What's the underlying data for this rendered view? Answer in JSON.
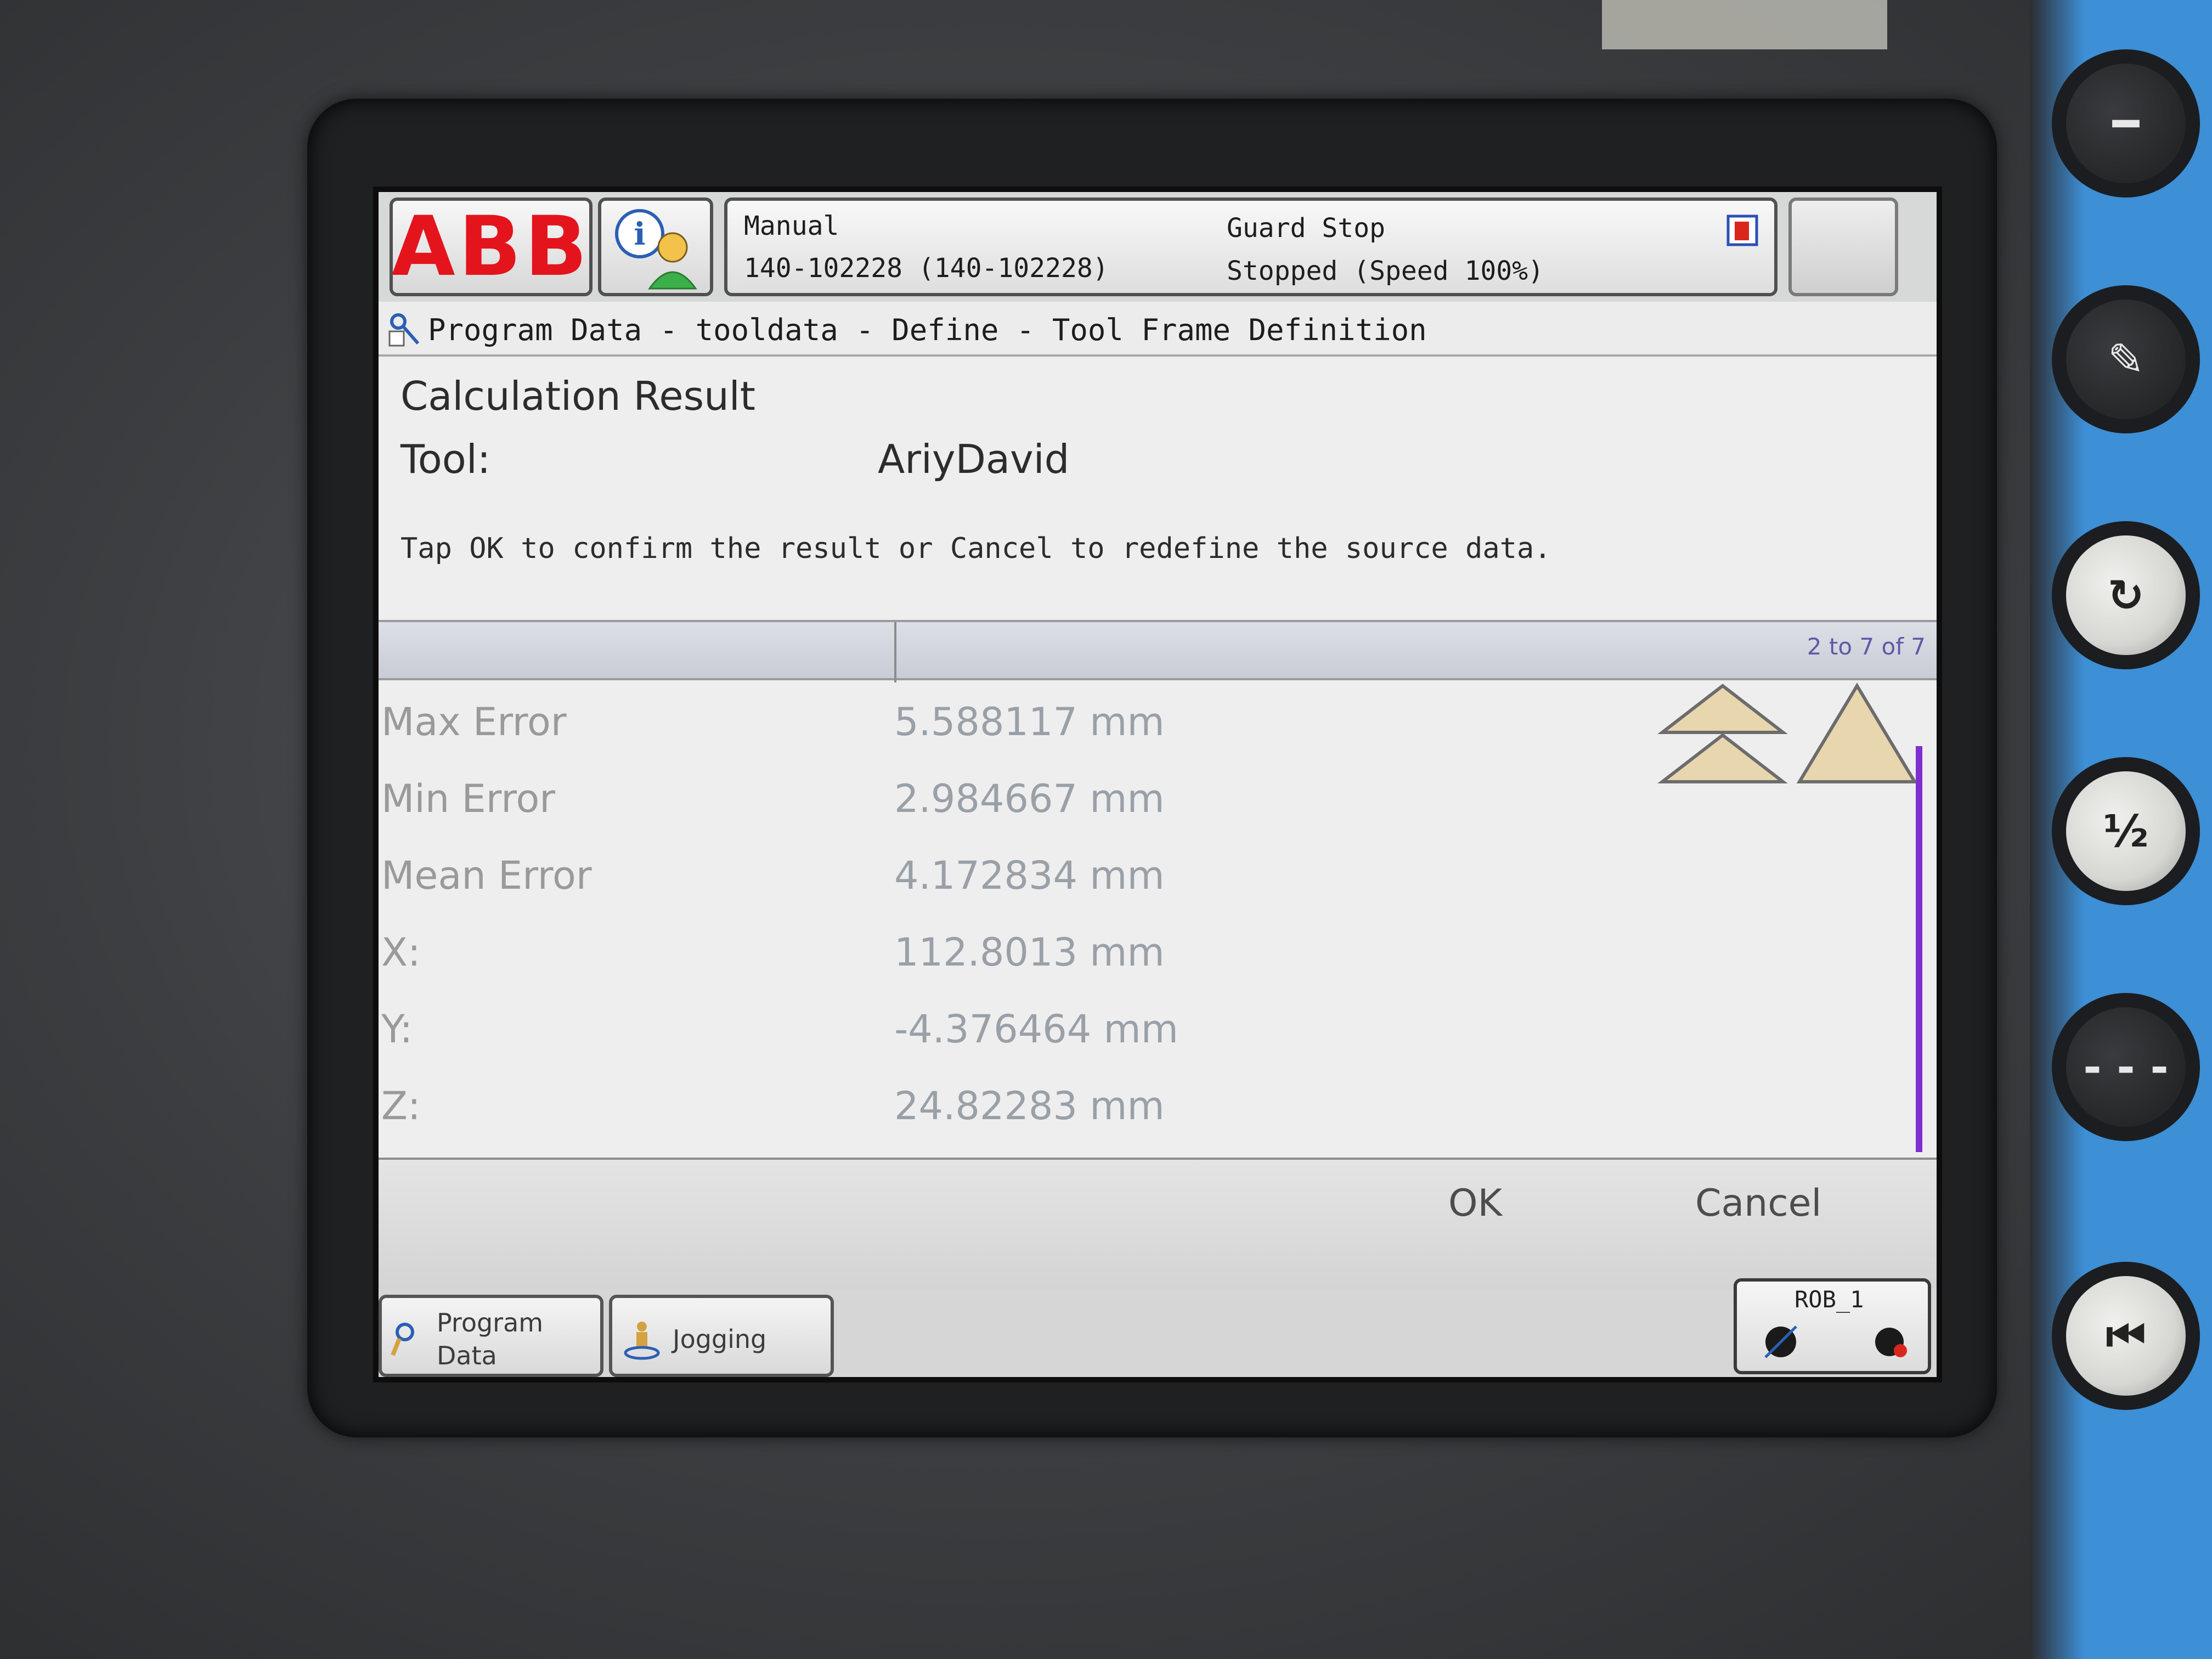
{
  "header": {
    "logo_text": "ABB",
    "mode": "Manual",
    "controller": "140-102228 (140-102228)",
    "guard_status": "Guard Stop",
    "run_status": "Stopped (Speed 100%)"
  },
  "breadcrumb": "Program Data - tooldata - Define - Tool Frame Definition",
  "result": {
    "title": "Calculation Result",
    "tool_label": "Tool:",
    "tool_value": "AriyDavid",
    "instruction": "Tap OK to confirm the result or Cancel to redefine the source data."
  },
  "grid": {
    "pager": "2 to 7 of 7",
    "rows": [
      {
        "label": "Max Error",
        "value": "5.588117 mm"
      },
      {
        "label": "Min Error",
        "value": "2.984667 mm"
      },
      {
        "label": "Mean Error",
        "value": "4.172834 mm"
      },
      {
        "label": "X:",
        "value": "112.8013 mm"
      },
      {
        "label": "Y:",
        "value": "-4.376464 mm"
      },
      {
        "label": "Z:",
        "value": "24.82283 mm"
      }
    ]
  },
  "actions": {
    "ok_label": "OK",
    "cancel_label": "Cancel"
  },
  "taskbar": {
    "program_data_line1": "Program",
    "program_data_line2": "Data",
    "jogging_label": "Jogging",
    "robot_label": "ROB_1"
  },
  "colors": {
    "abb_red": "#e4141d",
    "scrollbar": "#7f2fd0",
    "triangle_fill": "#e8d6ae"
  }
}
